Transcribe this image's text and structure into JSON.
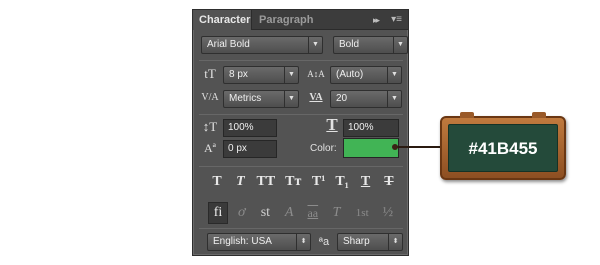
{
  "tabs": {
    "active": "Character",
    "inactive": "Paragraph",
    "collapse_glyph": "▸▸",
    "menu_glyph": "▾≡"
  },
  "font": {
    "family": "Arial Bold",
    "style": "Bold"
  },
  "size": {
    "icon": "tT",
    "value": "8 px"
  },
  "leading": {
    "icon": "A↕A",
    "value": "(Auto)"
  },
  "kerning": {
    "icon": "V/A",
    "value": "Metrics"
  },
  "tracking": {
    "icon": "VA",
    "value": "20"
  },
  "vertical_scale": {
    "icon": "↕T",
    "value": "100%"
  },
  "horizontal_scale": {
    "icon": "T",
    "value": "100%"
  },
  "baseline_shift": {
    "icon": "Aª",
    "value": "0 px"
  },
  "color": {
    "label": "Color:",
    "value": "#41b455"
  },
  "type_styles": [
    "T",
    "T",
    "TT",
    "Tт",
    "T¹",
    "T₁",
    "T",
    "T"
  ],
  "opentype": [
    "fi",
    "ơ",
    "st",
    "A",
    "aa",
    "T",
    "1st",
    "½"
  ],
  "language": {
    "value": "English: USA",
    "icon": "ªa"
  },
  "antialias": {
    "value": "Sharp"
  },
  "callout": {
    "text": "#41B455"
  }
}
